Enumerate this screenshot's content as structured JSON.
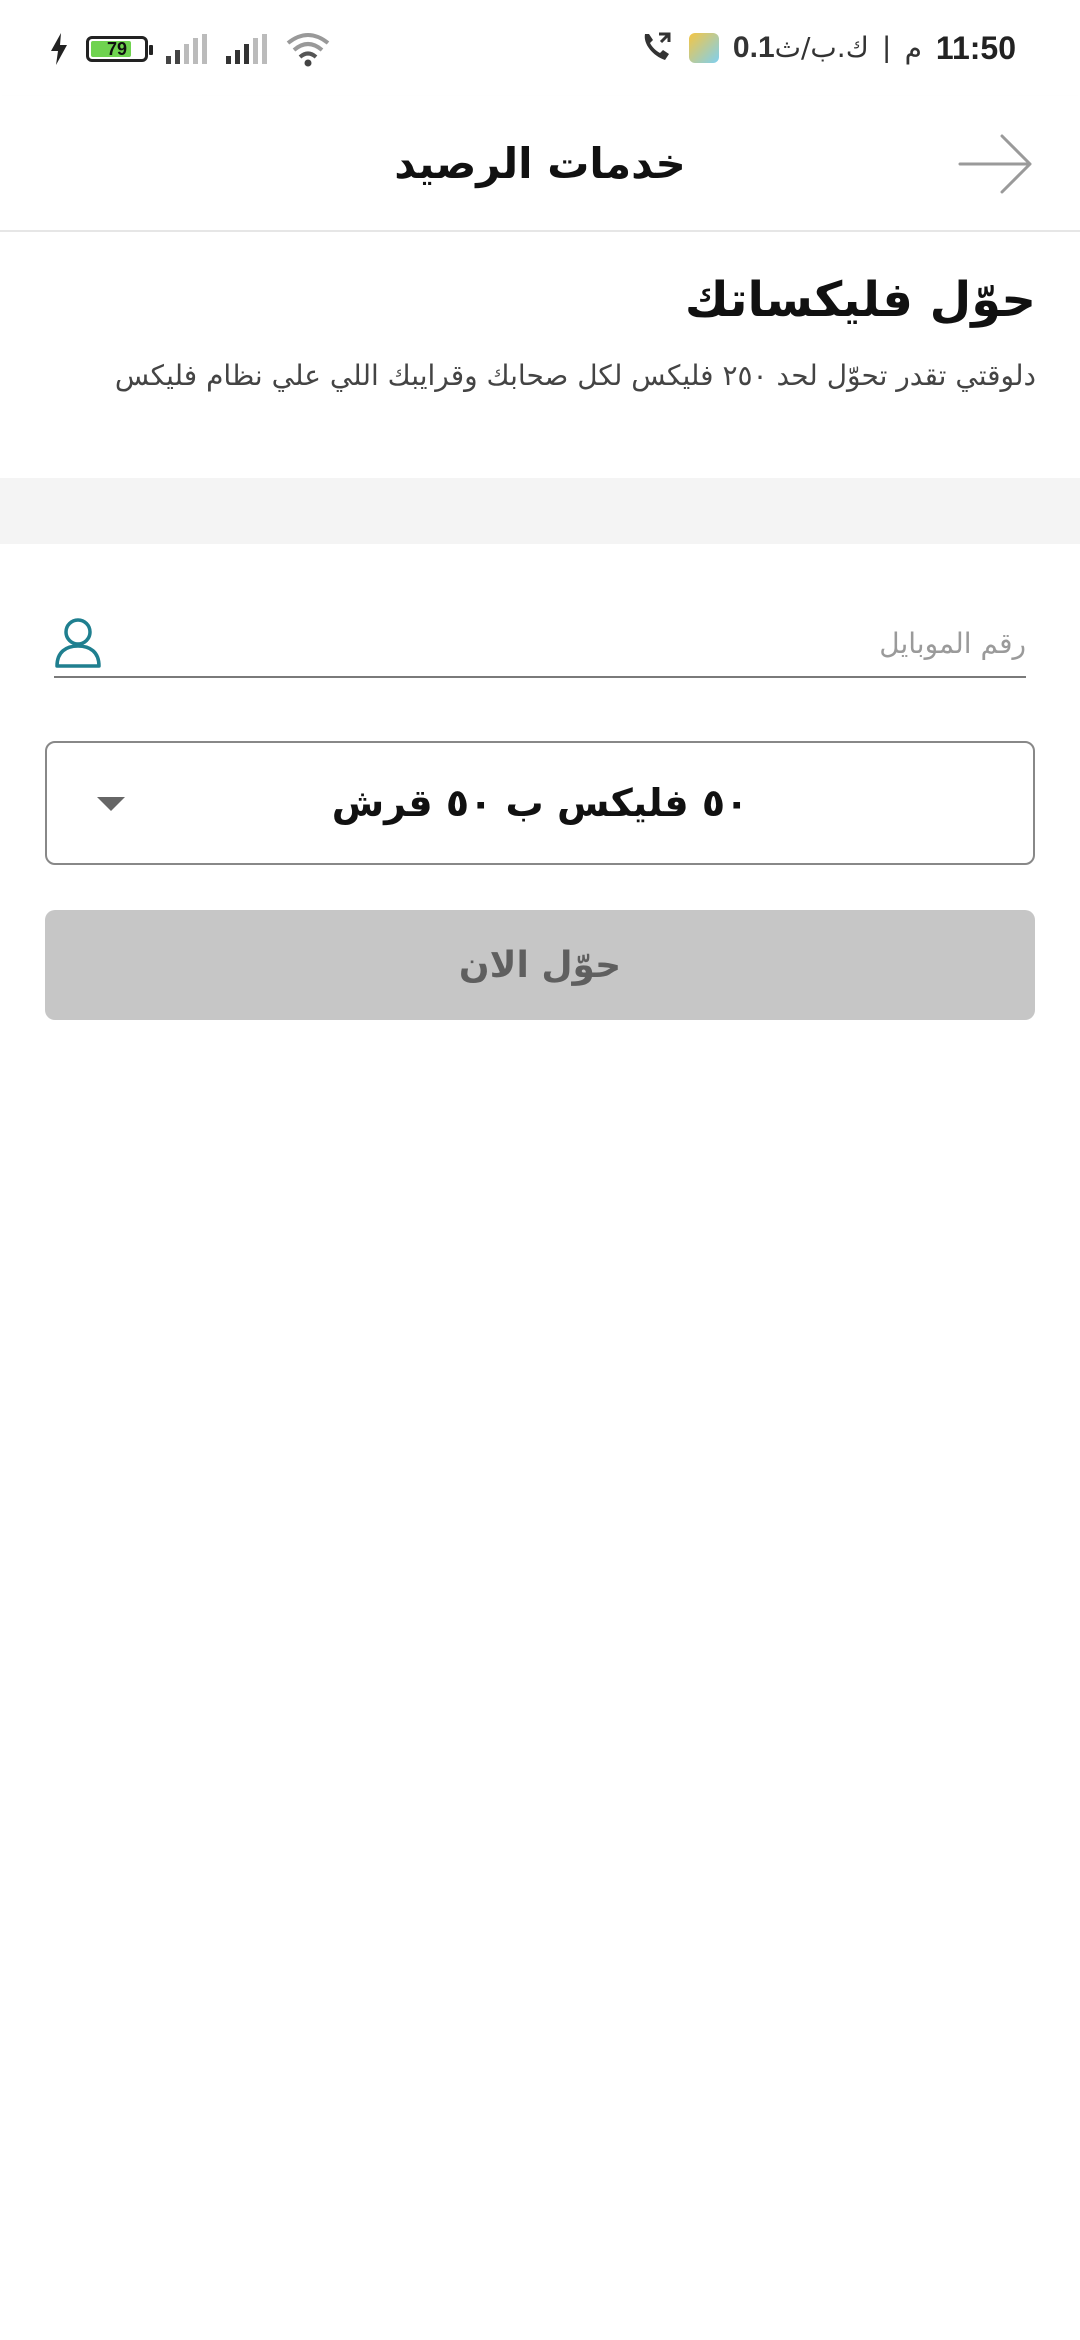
{
  "status_bar": {
    "time": "11:50",
    "ampm": "م",
    "separator": "|",
    "speed_value": "0.1",
    "speed_unit": "ك.ب/ث",
    "battery_level": "79",
    "battery_fill_percent": 79
  },
  "header": {
    "title": "خدمات الرصيد"
  },
  "intro": {
    "title": "حوّل فليكساتك",
    "description": "دلوقتي تقدر تحوّل لحد ٢٥٠ فليكس لكل صحابك وقرايبك اللي علي نظام فليكس"
  },
  "form": {
    "phone_placeholder": "رقم الموبايل",
    "phone_value": "",
    "bundle_selected": "٥٠ فليكس ب ٥٠ قرش",
    "submit_label": "حوّل الان"
  },
  "colors": {
    "accent_icon": "#1f7f8f",
    "button_disabled_bg": "#c6c6c6",
    "button_disabled_text": "#5f5f5f"
  }
}
